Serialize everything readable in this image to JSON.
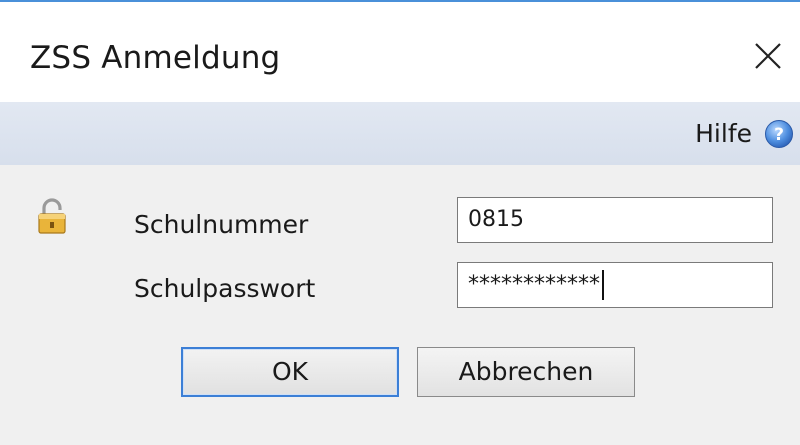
{
  "window": {
    "title": "ZSS Anmeldung",
    "close_icon": "close-icon"
  },
  "help": {
    "label": "Hilfe",
    "icon": "help-icon"
  },
  "form": {
    "lock_icon": "lock-icon",
    "schulnummer_label": "Schulnummer",
    "schulnummer_value": "0815",
    "schulpasswort_label": "Schulpasswort",
    "schulpasswort_value": "************"
  },
  "buttons": {
    "ok_label": "OK",
    "cancel_label": "Abbrechen"
  },
  "colors": {
    "accent": "#3c7fd6",
    "help_bar": "#dce3ee",
    "client_bg": "#f0f0f0"
  }
}
